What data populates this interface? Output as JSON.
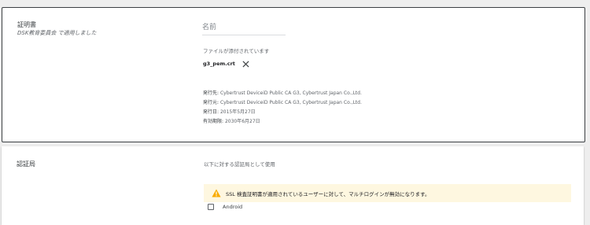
{
  "certificate": {
    "title": "証明書",
    "subtitle": "DSK教育委員会 で適用しました",
    "name_placeholder": "名前",
    "name_value": "",
    "attached_label": "ファイルが添付されています",
    "file_name": "g3_pem.crt",
    "details": [
      {
        "key": "発行先:",
        "value": "Cybertrust DeviceiD Public CA G3, Cybertrust Japan Co.,Ltd."
      },
      {
        "key": "発行元:",
        "value": "Cybertrust DeviceiD Public CA G3, Cybertrust Japan Co.,Ltd."
      },
      {
        "key": "発行日:",
        "value": "2015年5月27日"
      },
      {
        "key": "有効期限:",
        "value": "2030年6月27日"
      }
    ]
  },
  "authority": {
    "title": "認証局",
    "use_as_label": "以下に対する認証局として使用",
    "warning_text": "SSL 検査証明書が適用されているユーザーに対して、マルチログインが無効になります。",
    "checkbox_label": "Android"
  },
  "colors": {
    "warning_icon": "#f9ab00",
    "warning_bg": "#fef7e0"
  }
}
